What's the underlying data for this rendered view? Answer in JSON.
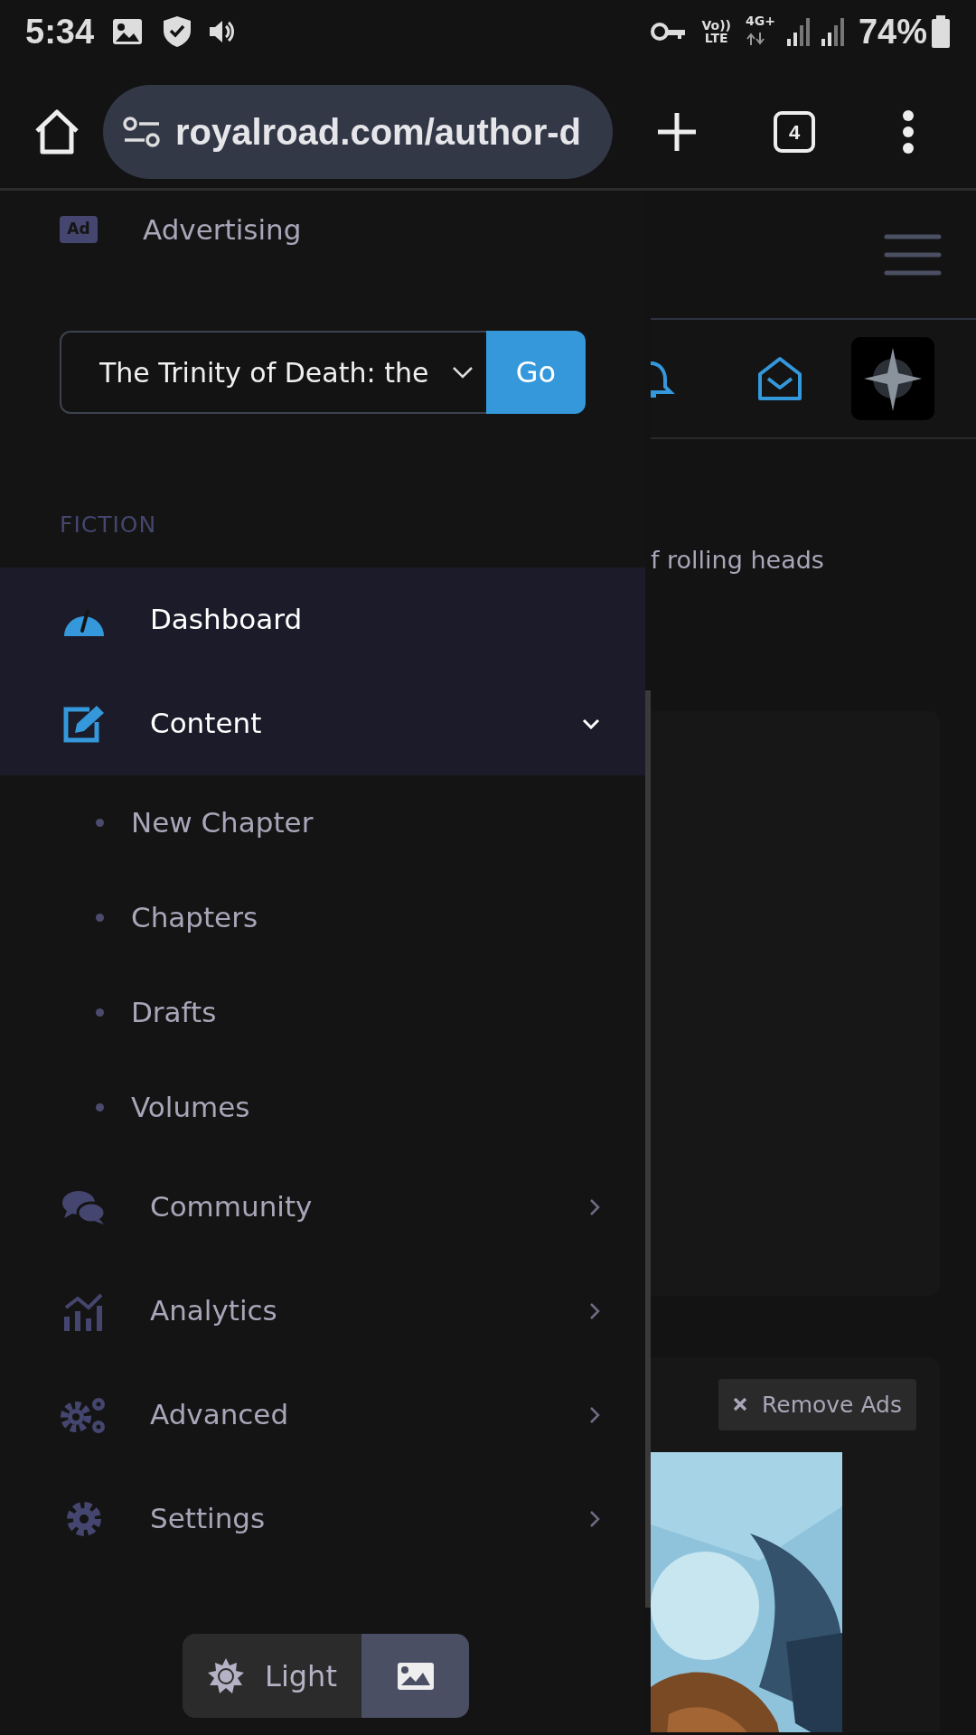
{
  "status_bar": {
    "time": "5:34",
    "volte": "Vo))",
    "lte": "LTE",
    "data": "4G+",
    "battery": "74%"
  },
  "browser": {
    "url": "royalroad.com/author-d",
    "tab_count": "4"
  },
  "page": {
    "subtitle": "f rolling heads",
    "remove_ads": "Remove Ads"
  },
  "drawer": {
    "top_item": {
      "badge": "Ad",
      "label": "Advertising"
    },
    "fiction_select": {
      "value": "The Trinity of Death: the",
      "button": "Go"
    },
    "section": "FICTION",
    "items": [
      {
        "label": "Dashboard",
        "kind": "link",
        "selected": true
      },
      {
        "label": "Content",
        "kind": "group",
        "selected": true,
        "expanded": true,
        "children": [
          {
            "label": "New Chapter"
          },
          {
            "label": "Chapters"
          },
          {
            "label": "Drafts"
          },
          {
            "label": "Volumes"
          }
        ]
      },
      {
        "label": "Community",
        "kind": "group",
        "selected": false,
        "expanded": false
      },
      {
        "label": "Analytics",
        "kind": "group",
        "selected": false,
        "expanded": false
      },
      {
        "label": "Advanced",
        "kind": "group",
        "selected": false,
        "expanded": false
      },
      {
        "label": "Settings",
        "kind": "group",
        "selected": false,
        "expanded": false
      }
    ]
  },
  "theme_toggle": [
    {
      "label": "Light",
      "selected": false
    },
    {
      "selected": true
    }
  ]
}
